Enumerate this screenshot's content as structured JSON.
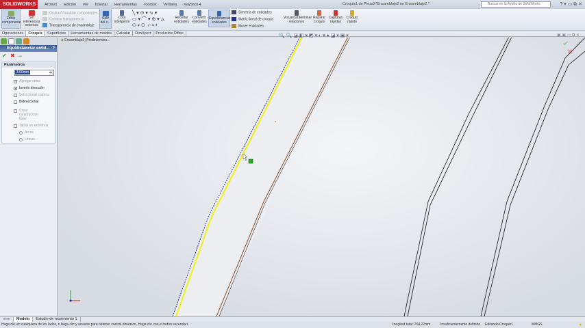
{
  "app": {
    "logo": "SOLIDWORKS",
    "title": "Croquis1 de Pieza2^Ensamblaje2 en Ensamblaje2 *",
    "search_placeholder": "Buscar en la Ayuda de SolidWorks"
  },
  "menu": [
    "Archivo",
    "Edición",
    "Ver",
    "Insertar",
    "Herramientas",
    "Toolbox",
    "Ventana",
    "KeyShot 4"
  ],
  "ribbon": {
    "edit_component": "Editar componente",
    "no_refs": "Sin referencias externas",
    "hide_show": "Ocultar/Visualizar componentes",
    "change_transp": "Cambiar transparencia",
    "assembly_transp": "Transparencia de ensamblaje",
    "exit_sketch": "Salir del c...",
    "smart_dim": "Cota inteligente",
    "trim": "Recortar entidades",
    "convert": "Convertir entidades",
    "offset": "Equidistanciar entidades",
    "mirror": "Simetría de entidades",
    "linear_pattern": "Matriz lineal de croquis",
    "move": "Mover entidades",
    "relations": "Visualizar/Eliminar relaciones",
    "repair": "Reparar croquis",
    "quick_snaps": "Capturas rápidas",
    "rapid_sketch": "Croquis rápido"
  },
  "tabs": [
    "Operaciones",
    "Croquis",
    "Superficies",
    "Herramientas de moldes",
    "Calcular",
    "DimXpert",
    "Productos Office"
  ],
  "active_tab": "Croquis",
  "panel": {
    "title": "Equidistanciar entid...",
    "help": "?",
    "section": "Parámetros",
    "distance": "3.00mm",
    "options": [
      {
        "label": "Agregar cotas",
        "checked": true,
        "enabled": false
      },
      {
        "label": "Invertir dirección",
        "checked": true,
        "enabled": true
      },
      {
        "label": "Seleccionar cadena",
        "checked": false,
        "enabled": false
      },
      {
        "label": "Bidireccional",
        "checked": false,
        "enabled": true
      },
      {
        "label": "Crear construcción base",
        "checked": false,
        "enabled": false
      },
      {
        "label": "Tapas en extremos",
        "checked": false,
        "enabled": false
      },
      {
        "label": "Arcos",
        "checked": true,
        "enabled": false
      },
      {
        "label": "Lineas",
        "checked": false,
        "enabled": false
      }
    ]
  },
  "tree": {
    "root": "Ensamblaje2 (Predetermina..."
  },
  "bottom_tabs": [
    "Modelo",
    "Estudio de movimiento 1"
  ],
  "status": {
    "hint": "Haga clic en cualquiera de los lados, o haga clic y arrastre para obtener control dinámico. Haga clic con el botón secundari...",
    "length": "Longitud total: 204.22mm",
    "definition": "Insuficientemente definido",
    "editing": "Editando Croquis1",
    "units": "MMGS"
  },
  "colors": {
    "offset_preview": "#f0f020",
    "selected": "#1838c0",
    "brown": "#8a4a20"
  }
}
